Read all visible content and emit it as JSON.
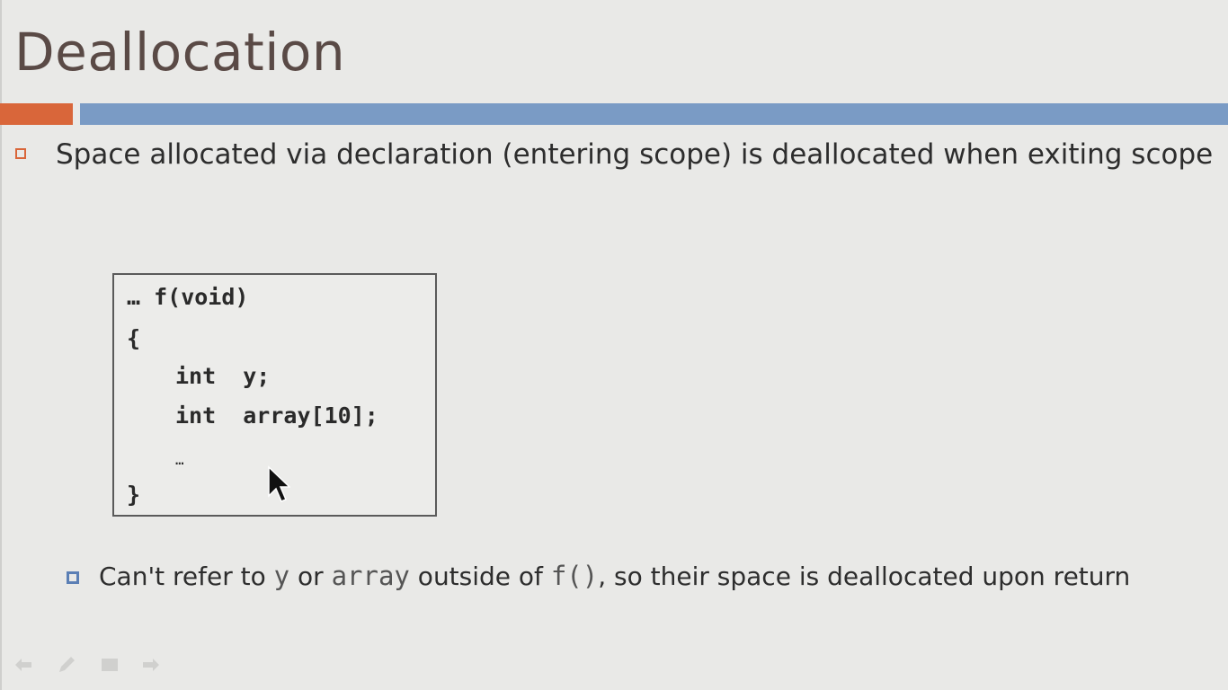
{
  "slide": {
    "title": "Deallocation",
    "accent_orange": "#d9663a",
    "accent_blue": "#7a9bc5"
  },
  "bullet1": {
    "text": "Space allocated via declaration (entering scope) is deallocated when exiting scope"
  },
  "code": {
    "line1": "… f(void)",
    "line2": "{",
    "line3": "int  y;",
    "line4": "int  array[10];",
    "line5": "…",
    "line6": "}"
  },
  "bullet2": {
    "part1": "Can't refer to ",
    "code1": "y",
    "part2": " or ",
    "code2": "array",
    "part3": " outside of ",
    "code3": " f()",
    "part4": ", so their space is deallocated upon return"
  },
  "nav": {
    "icons": [
      "back-arrow-icon",
      "pen-icon",
      "menu-icon",
      "forward-arrow-icon"
    ]
  }
}
